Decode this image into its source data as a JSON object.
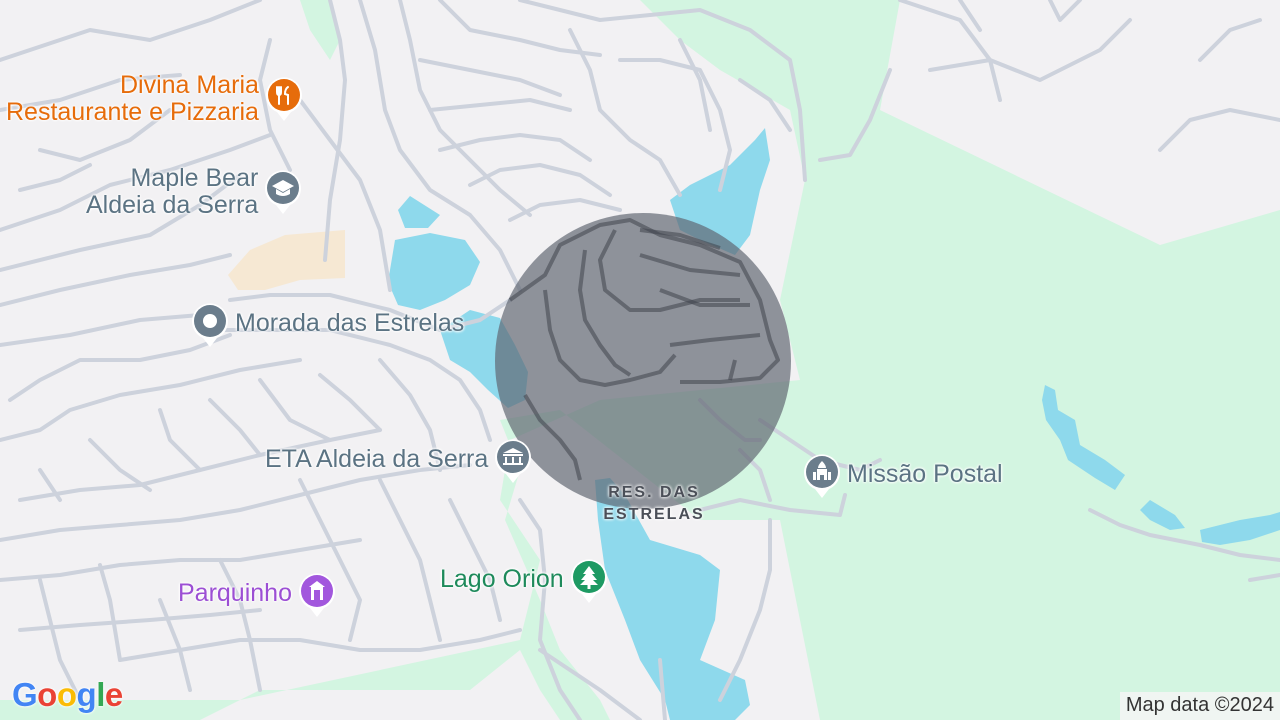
{
  "map": {
    "colors": {
      "land": "#f2f1f3",
      "park": "#d3f5e1",
      "water": "#8ed9ec",
      "road": "#cdd2dc",
      "sand": "#f6e8d3",
      "radius_overlay": "#5f6470"
    },
    "pois": [
      {
        "name": "Divina Maria\nRestaurante e Pizzaria",
        "icon": "restaurant-icon",
        "color": "#e66c0b"
      },
      {
        "name": "Maple Bear\nAldeia da Serra",
        "icon": "school-icon",
        "color": "#5b7383"
      },
      {
        "name": "Morada das Estrelas",
        "icon": "place-pin-icon",
        "color": "#5b7383"
      },
      {
        "name": "ETA Aldeia da Serra",
        "icon": "water-treatment-icon",
        "color": "#5b7383"
      },
      {
        "name": "Missão Postal",
        "icon": "worship-icon",
        "color": "#5b7383"
      },
      {
        "name": "Lago Orion",
        "icon": "park-tree-icon",
        "color": "#1e8a5b"
      },
      {
        "name": "Parquinho",
        "icon": "playground-icon",
        "color": "#9c4fd4"
      }
    ],
    "area_label": "RES. DAS\nESTRELAS",
    "logo": {
      "letters": [
        {
          "ch": "G",
          "color": "#4285f4"
        },
        {
          "ch": "o",
          "color": "#ea4335"
        },
        {
          "ch": "o",
          "color": "#fbbc05"
        },
        {
          "ch": "g",
          "color": "#4285f4"
        },
        {
          "ch": "l",
          "color": "#34a853"
        },
        {
          "ch": "e",
          "color": "#ea4335"
        }
      ]
    },
    "attribution": "Map data ©2024"
  }
}
